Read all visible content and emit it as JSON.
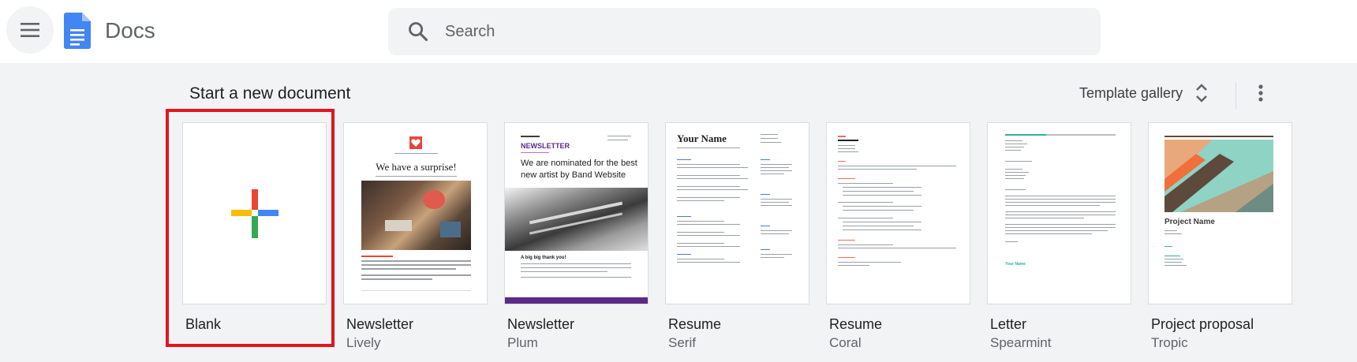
{
  "header": {
    "app_title": "Docs",
    "menu_icon": "hamburger-menu-icon",
    "logo_icon": "google-docs-logo-icon",
    "search": {
      "placeholder": "Search",
      "icon": "search-icon"
    }
  },
  "templates": {
    "section_title": "Start a new document",
    "gallery_label": "Template gallery",
    "gallery_icon": "unfold-more-icon",
    "more_icon": "more-vert-icon",
    "items": [
      {
        "title": "Blank",
        "subtitle": ""
      },
      {
        "title": "Newsletter",
        "subtitle": "Lively"
      },
      {
        "title": "Newsletter",
        "subtitle": "Plum"
      },
      {
        "title": "Resume",
        "subtitle": "Serif"
      },
      {
        "title": "Resume",
        "subtitle": "Coral"
      },
      {
        "title": "Letter",
        "subtitle": "Spearmint"
      },
      {
        "title": "Project proposal",
        "subtitle": "Tropic"
      }
    ],
    "previews": {
      "lively_heading": "We have a surprise!",
      "plum_brand": "NEWSLETTER",
      "plum_heading": "We are nominated for the best new artist by Band Website",
      "plum_sub": "A big big thank you!",
      "serif_name": "Your Name",
      "proposal_name": "Project Name",
      "letter_sign": "Your Name"
    }
  },
  "colors": {
    "accent_blue": "#4285f4",
    "accent_red": "#ea4335",
    "accent_yellow": "#fbbc04",
    "accent_green": "#34a853",
    "selection": "#e0161f",
    "plum": "#5b2a86",
    "coral": "#e8715a",
    "spearmint": "#2bb39c"
  }
}
